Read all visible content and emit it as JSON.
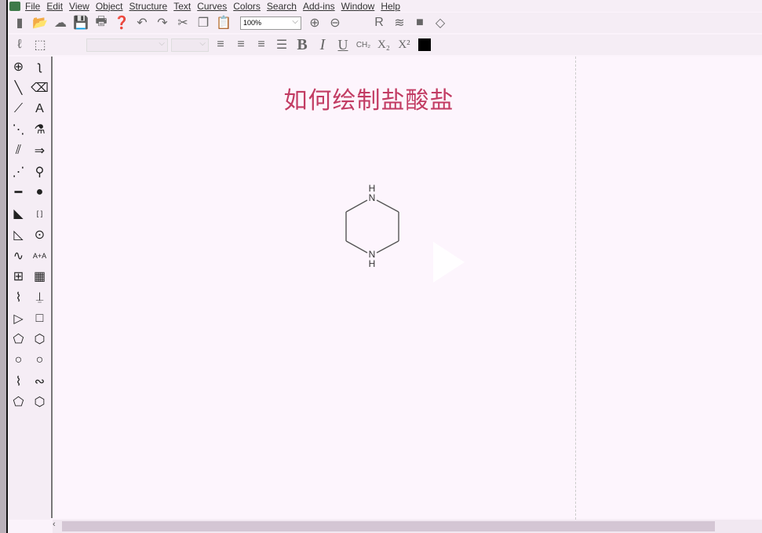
{
  "menu": [
    "File",
    "Edit",
    "View",
    "Object",
    "Structure",
    "Text",
    "Curves",
    "Colors",
    "Search",
    "Add-ins",
    "Window",
    "Help"
  ],
  "toolbar1": {
    "icons": [
      "new-document",
      "open",
      "open-online",
      "save",
      "print",
      "help",
      "undo",
      "redo",
      "cut",
      "copy",
      "paste"
    ],
    "zoom_value": "100%",
    "icons2": [
      "zoom-in",
      "zoom-out"
    ],
    "icons3": [
      "r-group",
      "reaction",
      "shade",
      "stereo-warning"
    ]
  },
  "toolbar2": {
    "icons": [
      "lasso",
      "marquee-select"
    ],
    "align_icons": [
      "align-left",
      "align-center",
      "align-right",
      "justify"
    ],
    "bold": "B",
    "italic": "I",
    "underline": "U",
    "formula": "CH₂",
    "subscript": "X₂",
    "superscript": "X²",
    "color": "#000000"
  },
  "tools": [
    "ring-lasso",
    "chain",
    "solid-bond",
    "eraser",
    "bold-bond",
    "text",
    "dashed-bond",
    "templates",
    "hashed-bond",
    "arrow",
    "hashed-wedge",
    "pen",
    "bold-line",
    "orbital",
    "wedge-bond",
    "brackets",
    "hollow-wedge",
    "charge",
    "wavy-bond",
    "atom-map",
    "table",
    "tlc-plate",
    "chain-tool",
    "stamp",
    "triangle",
    "square",
    "pentagon",
    "hexagon",
    "heptagon",
    "cyclohexane",
    "chair-1",
    "chair-2",
    "cyclopentane",
    "benzene"
  ],
  "canvas": {
    "title": "如何绘制盐酸盐",
    "molecule": {
      "name": "piperazine",
      "atoms": [
        "N",
        "H",
        "N",
        "H"
      ]
    },
    "title_color": "#c23c63"
  }
}
